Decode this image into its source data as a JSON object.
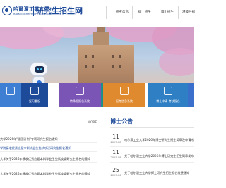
{
  "header": {
    "school_name": "哈爾濱工業大學",
    "school_en": "HARBIN INSTITUTE OF TECHNOLOGY",
    "site_title": "研究生招生网",
    "nav": [
      {
        "label": "招考信息"
      },
      {
        "label": "硕士招生"
      },
      {
        "label": "博士招生"
      },
      {
        "label": "港澳台招"
      }
    ]
  },
  "tiles": [
    {
      "label": "",
      "color": "#3e7ed3"
    },
    {
      "label": "复习看板",
      "color": "#1e4a9a"
    },
    {
      "label": "特殊限报名系统",
      "color": "#7b55b6"
    },
    {
      "label": "",
      "color": "#1f8f8a"
    },
    {
      "label": "报考信息系统",
      "color": "#e08a2f"
    },
    {
      "label": "博士申请-考核报名",
      "color": "#2f7fc4"
    },
    {
      "label": "",
      "color": "#3b6fcc"
    }
  ],
  "news": {
    "more_label": "MORE",
    "items": [
      {
        "text": "大学2026年\"强国计划\"专项研究生报名通知",
        "highlight": false
      },
      {
        "text": "学院接收优秀应届本科毕业生免试攻读研究生报名通知",
        "highlight": true
      },
      {
        "text": "大学关于2026年接收优秀应届本科毕业生免试攻读研究生报名的通知",
        "highlight": false
      },
      {
        "text": "大学关于2026年接收优秀应届本科毕业生免试攻读研究生报名的通知",
        "highlight": false
      }
    ]
  },
  "doctoral": {
    "title": "博士公告",
    "items": [
      {
        "day": "11",
        "ym": "2025-08",
        "text": "哈尔滨工业大学2026年博士研究生招生简章及申请考核"
      },
      {
        "day": "11",
        "ym": "2025-08",
        "text": "关于哈尔滨工业大学2026年博士研究生招生简章发布"
      },
      {
        "day": "25",
        "ym": "2025-06",
        "text": "关于哈尔滨工业大学博士研究生招生报名缴费通知"
      }
    ]
  }
}
